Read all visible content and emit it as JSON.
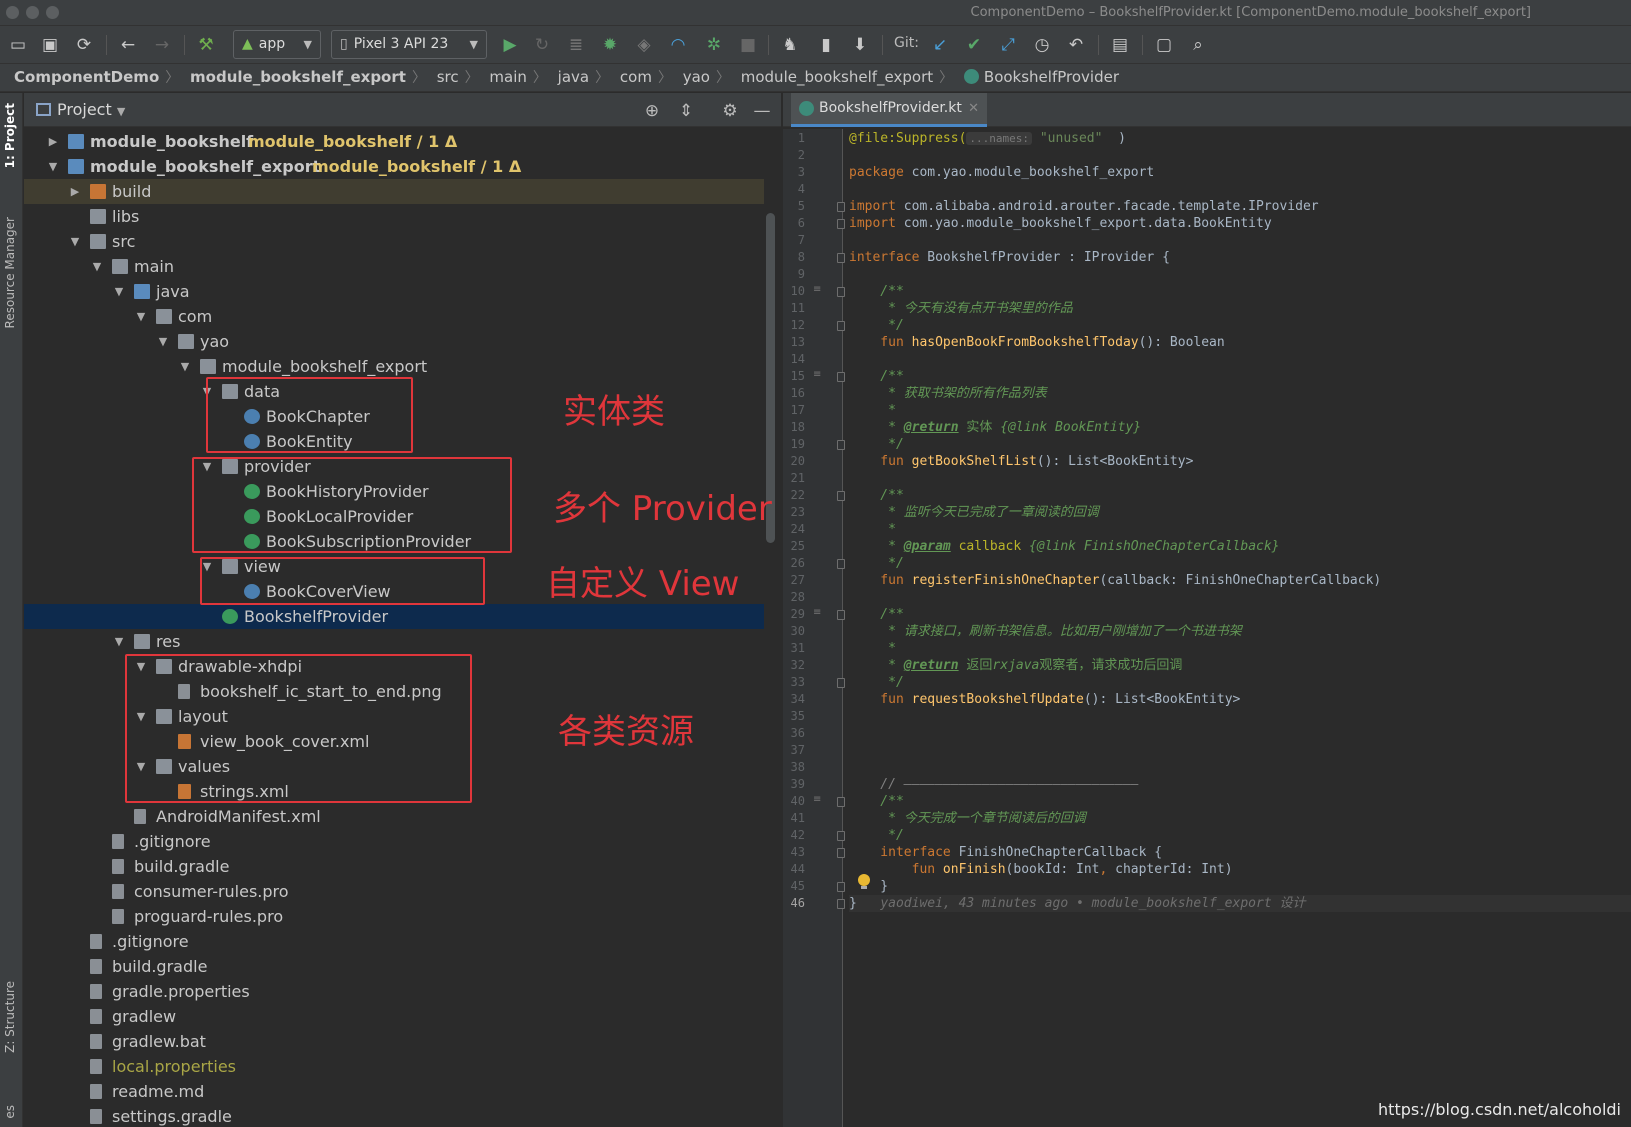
{
  "window": {
    "title": "ComponentDemo – BookshelfProvider.kt [ComponentDemo.module_bookshelf_export]"
  },
  "toolbar": {
    "run_config": "app",
    "device": "Pixel 3 API 23",
    "git_label": "Git:",
    "icons": [
      "open-icon",
      "save-icon",
      "sync-icon",
      "back-icon",
      "forward-icon",
      "build-hammer-icon",
      "android-icon",
      "run-icon",
      "rerun-icon",
      "coverage-icon",
      "debug-icon",
      "attach-debugger-icon",
      "profile-icon",
      "apply-changes-icon",
      "stop-icon",
      "gradle-sync-icon",
      "avd-manager-icon",
      "sdk-manager-icon",
      "git-update-icon",
      "git-commit-icon",
      "git-push-icon",
      "git-history-icon",
      "git-rollback-icon",
      "project-structure-icon",
      "terminal-icon",
      "search-icon"
    ]
  },
  "breadcrumb": [
    "ComponentDemo",
    "module_bookshelf_export",
    "src",
    "main",
    "java",
    "com",
    "yao",
    "module_bookshelf_export",
    "BookshelfProvider"
  ],
  "left_tool_tabs": [
    "1: Project",
    "Resource Manager",
    "Z: Structure",
    "es"
  ],
  "project_pane": {
    "title": "Project",
    "header_icons": [
      "locate-icon",
      "collapse-all-icon",
      "settings-gear-icon",
      "minimize-icon"
    ]
  },
  "tree": [
    {
      "label": "module_bookshelf",
      "suffix": "module_bookshelf / 1 Δ",
      "toggle": "▶",
      "icon": "module-folder-icon"
    },
    {
      "label": "module_bookshelf_export",
      "suffix": "module_bookshelf / 1 Δ",
      "toggle": "▼",
      "icon": "module-folder-icon"
    },
    {
      "label": "build",
      "toggle": "▶",
      "icon": "folder-icon"
    },
    {
      "label": "libs",
      "toggle": "",
      "icon": "folder-icon"
    },
    {
      "label": "src",
      "toggle": "▼",
      "icon": "folder-icon"
    },
    {
      "label": "main",
      "toggle": "▼",
      "icon": "folder-icon"
    },
    {
      "label": "java",
      "toggle": "▼",
      "icon": "source-folder-icon"
    },
    {
      "label": "com",
      "toggle": "▼",
      "icon": "package-icon"
    },
    {
      "label": "yao",
      "toggle": "▼",
      "icon": "package-icon"
    },
    {
      "label": "module_bookshelf_export",
      "toggle": "▼",
      "icon": "package-icon"
    },
    {
      "label": "data",
      "toggle": "▼",
      "icon": "package-icon"
    },
    {
      "label": "BookChapter",
      "toggle": "",
      "icon": "kotlin-class-icon"
    },
    {
      "label": "BookEntity",
      "toggle": "",
      "icon": "kotlin-class-icon"
    },
    {
      "label": "provider",
      "toggle": "▼",
      "icon": "package-icon"
    },
    {
      "label": "BookHistoryProvider",
      "toggle": "",
      "icon": "kotlin-interface-icon"
    },
    {
      "label": "BookLocalProvider",
      "toggle": "",
      "icon": "kotlin-interface-icon"
    },
    {
      "label": "BookSubscriptionProvider",
      "toggle": "",
      "icon": "kotlin-interface-icon"
    },
    {
      "label": "view",
      "toggle": "▼",
      "icon": "package-icon"
    },
    {
      "label": "BookCoverView",
      "toggle": "",
      "icon": "kotlin-class-icon"
    },
    {
      "label": "BookshelfProvider",
      "toggle": "",
      "icon": "kotlin-interface-icon"
    },
    {
      "label": "res",
      "toggle": "▼",
      "icon": "resource-folder-icon"
    },
    {
      "label": "drawable-xhdpi",
      "toggle": "▼",
      "icon": "folder-icon"
    },
    {
      "label": "bookshelf_ic_start_to_end.png",
      "toggle": "",
      "icon": "image-file-icon"
    },
    {
      "label": "layout",
      "toggle": "▼",
      "icon": "folder-icon"
    },
    {
      "label": "view_book_cover.xml",
      "toggle": "",
      "icon": "xml-file-icon"
    },
    {
      "label": "values",
      "toggle": "▼",
      "icon": "folder-icon"
    },
    {
      "label": "strings.xml",
      "toggle": "",
      "icon": "xml-file-icon"
    },
    {
      "label": "AndroidManifest.xml",
      "toggle": "",
      "icon": "manifest-file-icon"
    },
    {
      "label": ".gitignore",
      "toggle": "",
      "icon": "text-file-icon"
    },
    {
      "label": "build.gradle",
      "toggle": "",
      "icon": "gradle-icon"
    },
    {
      "label": "consumer-rules.pro",
      "toggle": "",
      "icon": "text-file-icon"
    },
    {
      "label": "proguard-rules.pro",
      "toggle": "",
      "icon": "text-file-icon"
    },
    {
      "label": ".gitignore",
      "toggle": "",
      "icon": "text-file-icon"
    },
    {
      "label": "build.gradle",
      "toggle": "",
      "icon": "gradle-icon"
    },
    {
      "label": "gradle.properties",
      "toggle": "",
      "icon": "properties-file-icon"
    },
    {
      "label": "gradlew",
      "toggle": "",
      "icon": "terminal-file-icon"
    },
    {
      "label": "gradlew.bat",
      "toggle": "",
      "icon": "text-file-icon"
    },
    {
      "label": "local.properties",
      "toggle": "",
      "icon": "properties-file-icon"
    },
    {
      "label": "readme.md",
      "toggle": "",
      "icon": "text-file-icon"
    },
    {
      "label": "settings.gradle",
      "toggle": "",
      "icon": "gradle-icon"
    }
  ],
  "annotations": {
    "entity": "实体类",
    "providers": "多个 Provider 接口",
    "custom_view": "自定义 View",
    "resources": "各类资源"
  },
  "editor": {
    "tab_label": "BookshelfProvider.kt",
    "tab_close": "✕",
    "code": [
      {
        "n": "1",
        "parts": [
          [
            "ann",
            "@file:Suppress("
          ],
          [
            "hint",
            "...names:"
          ],
          [
            "str",
            " \"unused\""
          ],
          [
            "",
            "  )"
          ]
        ]
      },
      {
        "n": "2",
        "parts": []
      },
      {
        "n": "3",
        "parts": [
          [
            "kw",
            "package"
          ],
          [
            "",
            " com.yao.module_bookshelf_export"
          ]
        ]
      },
      {
        "n": "4",
        "parts": []
      },
      {
        "n": "5",
        "parts": [
          [
            "kw",
            "import"
          ],
          [
            "",
            " com.alibaba.android.arouter.facade.template.IProvider"
          ]
        ]
      },
      {
        "n": "6",
        "parts": [
          [
            "kw",
            "import"
          ],
          [
            "",
            " com.yao.module_bookshelf_export.data.BookEntity"
          ]
        ]
      },
      {
        "n": "7",
        "parts": []
      },
      {
        "n": "8",
        "parts": [
          [
            "kw",
            "interface"
          ],
          [
            "",
            " BookshelfProvider : IProvider {"
          ]
        ]
      },
      {
        "n": "9",
        "parts": []
      },
      {
        "n": "10",
        "parts": [
          [
            "cmt",
            "    /**"
          ]
        ]
      },
      {
        "n": "11",
        "parts": [
          [
            "cmt",
            "     * 今天有没有点开书架里的作品"
          ]
        ]
      },
      {
        "n": "12",
        "parts": [
          [
            "cmt",
            "     */"
          ]
        ]
      },
      {
        "n": "13",
        "parts": [
          [
            "kw",
            "    fun "
          ],
          [
            "fn",
            "hasOpenBookFromBookshelfToday"
          ],
          [
            "",
            "(): Boolean"
          ]
        ]
      },
      {
        "n": "14",
        "parts": []
      },
      {
        "n": "15",
        "parts": [
          [
            "cmt",
            "    /**"
          ]
        ]
      },
      {
        "n": "16",
        "parts": [
          [
            "cmt",
            "     * 获取书架的所有作品列表"
          ]
        ]
      },
      {
        "n": "17",
        "parts": [
          [
            "cmt",
            "     *"
          ]
        ]
      },
      {
        "n": "18",
        "parts": [
          [
            "cmt",
            "     * "
          ],
          [
            "tag",
            "@return"
          ],
          [
            "cmt2",
            " 实体 "
          ],
          [
            "cmt",
            "{@link BookEntity}"
          ]
        ]
      },
      {
        "n": "19",
        "parts": [
          [
            "cmt",
            "     */"
          ]
        ]
      },
      {
        "n": "20",
        "parts": [
          [
            "kw",
            "    fun "
          ],
          [
            "fn",
            "getBookShelfList"
          ],
          [
            "",
            "(): List<BookEntity>"
          ]
        ]
      },
      {
        "n": "21",
        "parts": []
      },
      {
        "n": "22",
        "parts": [
          [
            "cmt",
            "    /**"
          ]
        ]
      },
      {
        "n": "23",
        "parts": [
          [
            "cmt",
            "     * 监听今天已完成了一章阅读的回调"
          ]
        ]
      },
      {
        "n": "24",
        "parts": [
          [
            "cmt",
            "     *"
          ]
        ]
      },
      {
        "n": "25",
        "parts": [
          [
            "cmt",
            "     * "
          ],
          [
            "tag",
            "@param"
          ],
          [
            "cmt",
            " "
          ],
          [
            "ann",
            "callback"
          ],
          [
            "cmt",
            " {@link FinishOneChapterCallback}"
          ]
        ]
      },
      {
        "n": "26",
        "parts": [
          [
            "cmt",
            "     */"
          ]
        ]
      },
      {
        "n": "27",
        "parts": [
          [
            "kw",
            "    fun "
          ],
          [
            "fn",
            "registerFinishOneChapter"
          ],
          [
            "",
            "(callback: FinishOneChapterCallback)"
          ]
        ]
      },
      {
        "n": "28",
        "parts": []
      },
      {
        "n": "29",
        "parts": [
          [
            "cmt",
            "    /**"
          ]
        ]
      },
      {
        "n": "30",
        "parts": [
          [
            "cmt",
            "     * 请求接口，刷新书架信息。比如用户刚增加了一个书进书架"
          ]
        ]
      },
      {
        "n": "31",
        "parts": [
          [
            "cmt",
            "     *"
          ]
        ]
      },
      {
        "n": "32",
        "parts": [
          [
            "cmt",
            "     * "
          ],
          [
            "tag",
            "@return"
          ],
          [
            "cmt2",
            " 返回"
          ],
          [
            "cmt",
            "rxjava"
          ],
          [
            "cmt2",
            "观察者，请求成功后回调"
          ]
        ]
      },
      {
        "n": "33",
        "parts": [
          [
            "cmt",
            "     */"
          ]
        ]
      },
      {
        "n": "34",
        "parts": [
          [
            "kw",
            "    fun "
          ],
          [
            "fn",
            "requestBookshelfUpdate"
          ],
          [
            "",
            "(): List<BookEntity>"
          ]
        ]
      },
      {
        "n": "35",
        "parts": []
      },
      {
        "n": "36",
        "parts": []
      },
      {
        "n": "37",
        "parts": []
      },
      {
        "n": "38",
        "parts": []
      },
      {
        "n": "39",
        "parts": [
          [
            "linecmt",
            "    // ——————————————————————————————"
          ]
        ]
      },
      {
        "n": "40",
        "parts": [
          [
            "cmt",
            "    /**"
          ]
        ]
      },
      {
        "n": "41",
        "parts": [
          [
            "cmt",
            "     * 今天完成一个章节阅读后的回调"
          ]
        ]
      },
      {
        "n": "42",
        "parts": [
          [
            "cmt",
            "     */"
          ]
        ]
      },
      {
        "n": "43",
        "parts": [
          [
            "kw",
            "    interface"
          ],
          [
            "",
            " FinishOneChapterCallback {"
          ]
        ]
      },
      {
        "n": "44",
        "parts": [
          [
            "kw",
            "        fun "
          ],
          [
            "fn",
            "onFinish"
          ],
          [
            "",
            "(bookId: Int"
          ],
          [
            "kw",
            ","
          ],
          [
            "",
            " chapterId: Int)"
          ]
        ]
      },
      {
        "n": "45",
        "parts": [
          [
            "",
            "    }"
          ]
        ]
      },
      {
        "n": "46",
        "parts": [
          [
            "",
            "}   "
          ],
          [
            "blame",
            "yaodiwei, 43 minutes ago • module_bookshelf_export 设计"
          ]
        ]
      }
    ]
  },
  "watermark": "https://blog.csdn.net/alcoholdi",
  "colors": {
    "accent_red": "#e0363b",
    "selection": "#0d2a4d",
    "module_yellow": "#e0c46c",
    "keyword": "#cc7832",
    "function": "#ffc66d",
    "comment": "#629755"
  }
}
